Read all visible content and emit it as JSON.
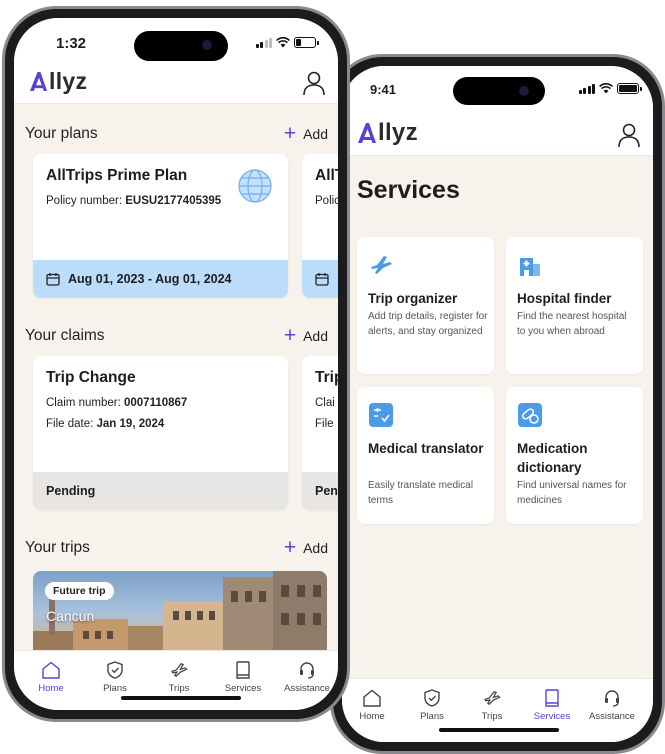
{
  "brand": {
    "name": "llyz",
    "accent": "#5b3fd6",
    "light_blue": "#bcdcfb",
    "bg": "#f7f3ec"
  },
  "left_phone": {
    "status": {
      "time": "1:32"
    },
    "header": {
      "logo_icon": "allyz-a-logo",
      "profile_icon": "user-icon"
    },
    "plans": {
      "title": "Your plans",
      "add_label": "Add",
      "cards": [
        {
          "title": "AllTrips Prime Plan",
          "policy_label": "Policy number:",
          "policy_number": "EUSU2177405395",
          "dates": "Aug 01, 2023 - Aug 01, 2024",
          "icon": "globe-icon"
        },
        {
          "title": "AllT",
          "policy_label": "Polic",
          "policy_number": "",
          "dates": "",
          "icon": "calendar-icon"
        }
      ]
    },
    "claims": {
      "title": "Your claims",
      "add_label": "Add",
      "cards": [
        {
          "title": "Trip Change",
          "number_label": "Claim number:",
          "number": "0007110867",
          "date_label": "File date:",
          "date": "Jan 19, 2024",
          "status": "Pending"
        },
        {
          "title": "Trip",
          "number_label": "Clai",
          "number": "",
          "date_label": "File",
          "date": "",
          "status": "Pen"
        }
      ]
    },
    "trips": {
      "title": "Your trips",
      "add_label": "Add",
      "card": {
        "badge": "Future trip",
        "city": "Cancun"
      }
    },
    "tabs": [
      {
        "label": "Home",
        "icon": "home-icon",
        "active": true
      },
      {
        "label": "Plans",
        "icon": "shield-icon",
        "active": false
      },
      {
        "label": "Trips",
        "icon": "plane-icon",
        "active": false
      },
      {
        "label": "Services",
        "icon": "book-icon",
        "active": false
      },
      {
        "label": "Assistance",
        "icon": "headset-icon",
        "active": false
      }
    ]
  },
  "right_phone": {
    "status": {
      "time": "9:41"
    },
    "page_title": "Services",
    "services": [
      {
        "name": "Trip organizer",
        "description": "Add trip details, register for alerts, and stay organized",
        "icon": "plane-icon"
      },
      {
        "name": "Hospital finder",
        "description": "Find the nearest hospital to you when abroad",
        "icon": "hospital-icon"
      },
      {
        "name": "Medical translator",
        "description": "Easily translate medical terms",
        "icon": "translate-icon"
      },
      {
        "name": "Medication dictionary",
        "description": "Find universal names for medicines",
        "icon": "pills-icon"
      }
    ],
    "tabs": [
      {
        "label": "Home",
        "icon": "home-icon",
        "active": false
      },
      {
        "label": "Plans",
        "icon": "shield-icon",
        "active": false
      },
      {
        "label": "Trips",
        "icon": "plane-icon",
        "active": false
      },
      {
        "label": "Services",
        "icon": "book-icon",
        "active": true
      },
      {
        "label": "Assistance",
        "icon": "headset-icon",
        "active": false
      }
    ]
  }
}
